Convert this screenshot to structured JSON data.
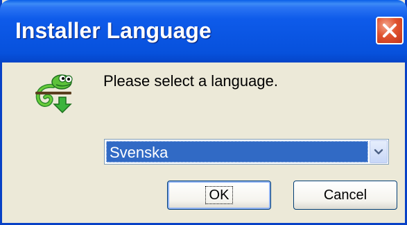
{
  "window": {
    "title": "Installer Language",
    "close_icon": "close-x-icon",
    "app_icon": "chameleon-installer-icon"
  },
  "dialog": {
    "prompt": "Please select a language.",
    "language_select": {
      "selected_value": "Svenska",
      "arrow_icon": "chevron-down-icon"
    },
    "buttons": {
      "ok_label": "OK",
      "cancel_label": "Cancel"
    }
  },
  "colors": {
    "titlebar": "#0A55E2",
    "dialog_background": "#ECE9D8",
    "selection": "#316AC5",
    "close_button": "#E0532E"
  }
}
